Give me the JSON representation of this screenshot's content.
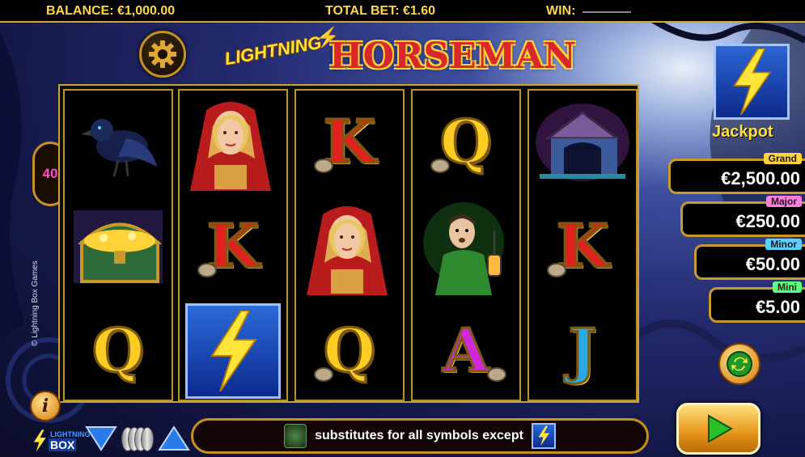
{
  "topbar": {
    "balance": "BALANCE: €1,000.00",
    "total_bet": "TOTAL BET: €1.60",
    "win": "WIN:"
  },
  "logo": {
    "line1": "LIGHTNING",
    "line2": "HORSEMAN"
  },
  "lines_badge": "40",
  "copyright": "© Lightning Box Games",
  "reels": [
    [
      "raven",
      "treasure-chest",
      "Q"
    ],
    [
      "red-hood-woman",
      "K",
      "lightning-wild"
    ],
    [
      "K",
      "red-hood-woman",
      "Q"
    ],
    [
      "Q",
      "horseman-with-lantern",
      "A"
    ],
    [
      "haunted-bridge",
      "K",
      "J"
    ]
  ],
  "jackpot": {
    "title": "Jackpot",
    "tiers": [
      {
        "label": "Grand",
        "value": "€2,500.00",
        "color": "#ffd23a"
      },
      {
        "label": "Major",
        "value": "€250.00",
        "color": "#ff7be0"
      },
      {
        "label": "Minor",
        "value": "€50.00",
        "color": "#5ad0ff"
      },
      {
        "label": "Mini",
        "value": "€5.00",
        "color": "#5aff7a"
      }
    ]
  },
  "bottom": {
    "brand_top": "LIGHTNING",
    "brand_bottom": "BOX",
    "message": "substitutes for all symbols except"
  },
  "colors": {
    "accent_gold": "#c8901e",
    "text_yellow": "#ffd84a",
    "wild_blue": "#1a4ac0"
  },
  "icons": {
    "settings": "gear-icon",
    "info": "info-icon",
    "autoplay": "autoplay-icon",
    "spin": "play-icon"
  }
}
